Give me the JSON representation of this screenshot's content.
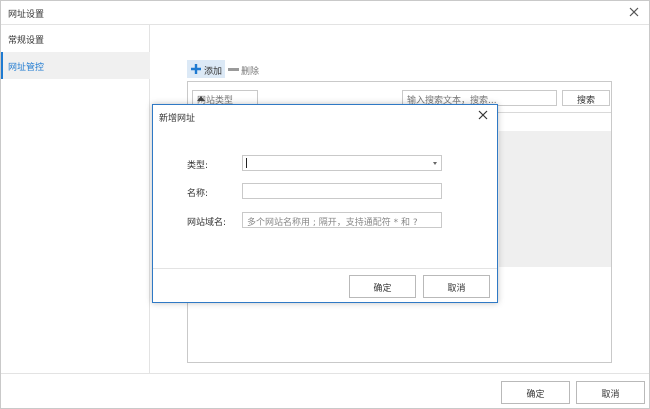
{
  "window": {
    "title": "网址设置"
  },
  "sidebar": {
    "items": [
      {
        "label": "常规设置"
      },
      {
        "label": "网址管控"
      }
    ]
  },
  "toolbar": {
    "add_label": "添加",
    "delete_label": "删除"
  },
  "panel": {
    "type_filter": "网站类型",
    "search_placeholder": "输入搜索文本，搜索...",
    "search_button": "搜索"
  },
  "footer": {
    "ok_label": "确定",
    "cancel_label": "取消"
  },
  "dialog": {
    "title": "新增网址",
    "type_label": "类型:",
    "type_value": "",
    "name_label": "名称:",
    "name_value": "",
    "domain_label": "网站域名:",
    "domain_placeholder": "多个网站名称用 ; 隔开，支持通配符 * 和 ?",
    "ok_label": "确定",
    "cancel_label": "取消"
  },
  "colors": {
    "accent": "#1e7ad1",
    "dialog_border": "#2f79c5",
    "active_bg": "#f0f0f0"
  },
  "icons": {
    "window_close": "close-icon",
    "dialog_close": "close-icon",
    "add": "plus-icon",
    "delete": "minus-icon"
  }
}
